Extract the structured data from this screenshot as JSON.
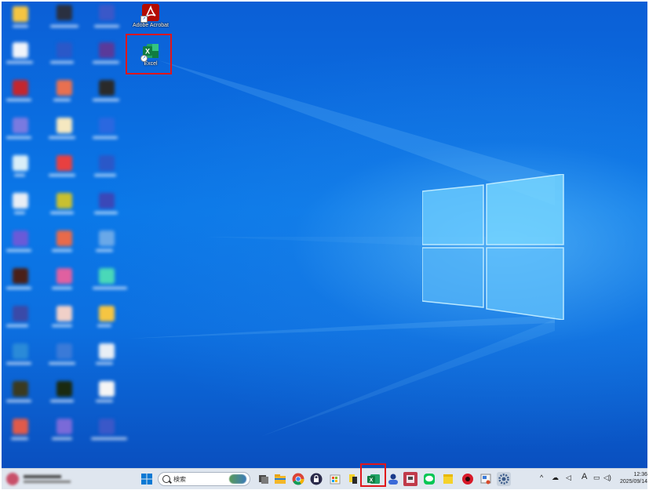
{
  "desktop": {
    "icons": [
      {
        "name": "Adobe Acrobat",
        "icon": "adobe-acrobat-icon"
      },
      {
        "name": "Excel",
        "icon": "excel-icon"
      }
    ]
  },
  "taskbar": {
    "search_placeholder": "検索",
    "ime_indicator": "A",
    "clock_time": "12:36",
    "clock_date": "2025/09/14",
    "pinned": [
      "file-explorer-icon",
      "chrome-icon",
      "lock-app-icon",
      "store-icon",
      "sticky-app-icon",
      "excel-icon",
      "user-app-icon",
      "paint-app-icon",
      "line-app-icon",
      "sticky-notes-icon",
      "record-icon",
      "snipping-icon",
      "settings-icon"
    ]
  },
  "colors": {
    "highlight": "#e0161b",
    "excel_green": "#107c41",
    "acrobat_red": "#b30b00"
  }
}
